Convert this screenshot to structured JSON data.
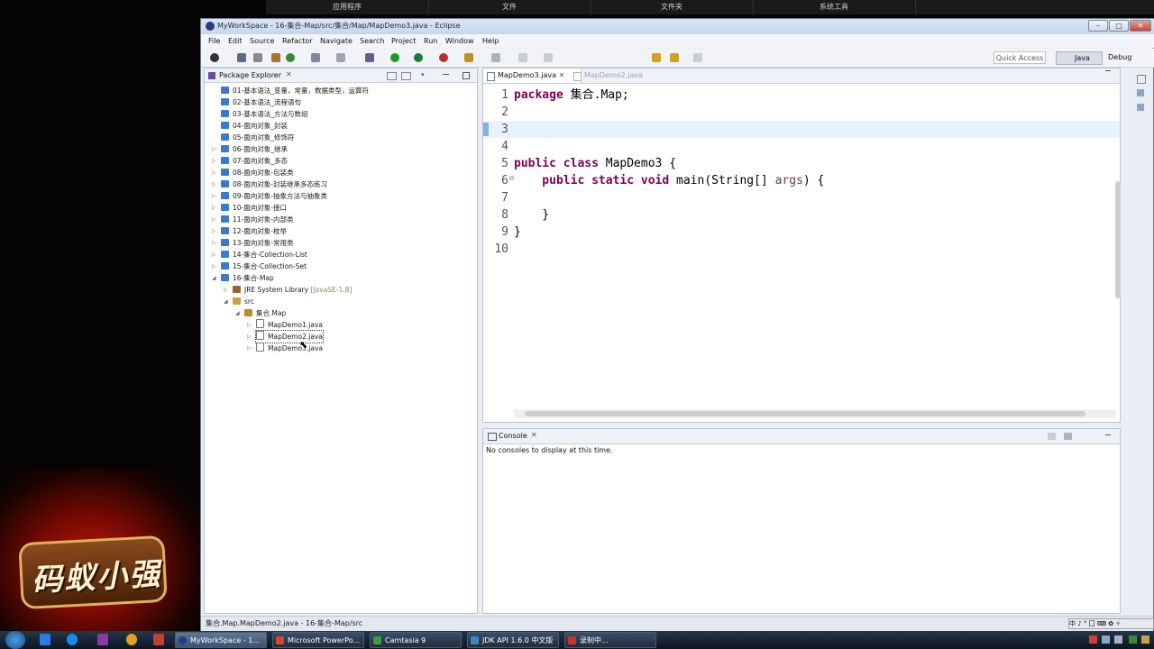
{
  "shell_menu": [
    "应用程序",
    "文件",
    "文件夹",
    "系统工具"
  ],
  "logo_text": "码蚁小强",
  "window": {
    "title": "MyWorkSpace - 16-集合-Map/src/集合/Map/MapDemo3.java - Eclipse",
    "controls": {
      "minimize": "–",
      "maximize": "□",
      "close": "✕"
    }
  },
  "menubar": [
    "File",
    "Edit",
    "Source",
    "Refactor",
    "Navigate",
    "Search",
    "Project",
    "Run",
    "Window",
    "Help"
  ],
  "toolbar": {
    "quick_access": "Quick Access",
    "perspective_java": "Java",
    "perspective_debug": "Debug"
  },
  "package_explorer": {
    "tab_label": "Package Explorer",
    "close_icon": "✕",
    "items": [
      {
        "label": "01-基本语法_变量，常量，数据类型，运算符"
      },
      {
        "label": "02-基本语法_流程语句"
      },
      {
        "label": "03-基本语法_方法与数组"
      },
      {
        "label": "04-面向对象_封装"
      },
      {
        "label": "05-面向对象_修饰符"
      },
      {
        "label": "06-面向对象_继承"
      },
      {
        "label": "07-面向对象_多态"
      },
      {
        "label": "08-面向对象-包装类"
      },
      {
        "label": "08-面向对象-封装继承多态练习"
      },
      {
        "label": "09-面向对象-抽象方法与抽象类"
      },
      {
        "label": "10-面向对象-接口"
      },
      {
        "label": "11-面向对象-内部类"
      },
      {
        "label": "12-面向对象-枚举"
      },
      {
        "label": "13-面向对象-常用类"
      },
      {
        "label": "14-集合-Collection-List"
      },
      {
        "label": "15-集合-Collection-Set"
      },
      {
        "label": "16-集合-Map"
      },
      {
        "label": "JRE System Library",
        "suffix": "[JavaSE-1.8]"
      },
      {
        "label": "src"
      },
      {
        "label": "集合.Map"
      },
      {
        "label": "MapDemo1.java"
      },
      {
        "label": "MapDemo2.java"
      },
      {
        "label": "MapDemo3.java"
      }
    ]
  },
  "editor": {
    "tabs": [
      {
        "label": "MapDemo3.java",
        "active": true
      },
      {
        "label": "MapDemo2.java",
        "active": false
      }
    ],
    "lines": [
      {
        "num": "1",
        "kw": "package",
        "rest": " 集合.Map;"
      },
      {
        "num": "2",
        "kw": "",
        "rest": ""
      },
      {
        "num": "3",
        "kw": "",
        "rest": ""
      },
      {
        "num": "4",
        "kw": "",
        "rest": ""
      },
      {
        "num": "5",
        "kw": "public class",
        "rest": " MapDemo3 {"
      },
      {
        "num": "6",
        "kw": "    public static void",
        "rest": " main(String[] ",
        "arg": "args",
        "tail": ") {"
      },
      {
        "num": "7",
        "kw": "",
        "rest": ""
      },
      {
        "num": "8",
        "kw": "",
        "rest": "    }"
      },
      {
        "num": "9",
        "kw": "",
        "rest": "}"
      },
      {
        "num": "10",
        "kw": "",
        "rest": ""
      }
    ]
  },
  "console": {
    "tab_label": "Console",
    "message": "No consoles to display at this time."
  },
  "statusbar": {
    "text": "集合.Map.MapDemo2.java - 16-集合-Map/src"
  },
  "taskbar": {
    "tasks": [
      {
        "label": "MyWorkSpace - 1..."
      },
      {
        "label": "Microsoft PowerPo..."
      },
      {
        "label": "Camtasia 9"
      },
      {
        "label": "JDK API 1.6.0 中文版"
      },
      {
        "label": "录制中..."
      }
    ],
    "ime": "中 ♪ ° 囗 ⌨ ✿ ✧"
  }
}
